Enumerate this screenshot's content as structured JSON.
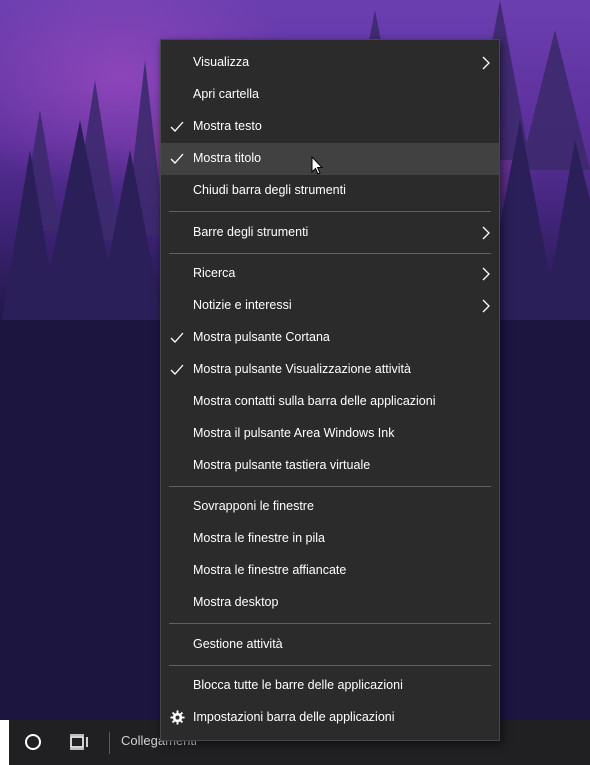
{
  "colors": {
    "menu_background": "#2b2b2b",
    "menu_hover": "#414141",
    "menu_text": "#ffffff",
    "separator": "#5f5f5f",
    "taskbar": "#202023"
  },
  "menu": {
    "items": [
      {
        "label": "Visualizza",
        "submenu": true,
        "checked": false
      },
      {
        "label": "Apri cartella",
        "submenu": false,
        "checked": false
      },
      {
        "label": "Mostra testo",
        "submenu": false,
        "checked": true
      },
      {
        "label": "Mostra titolo",
        "submenu": false,
        "checked": true,
        "hovered": true
      },
      {
        "label": "Chiudi barra degli strumenti",
        "submenu": false,
        "checked": false
      },
      {
        "label": "Barre degli strumenti",
        "submenu": true,
        "checked": false
      },
      {
        "label": "Ricerca",
        "submenu": true,
        "checked": false
      },
      {
        "label": "Notizie e interessi",
        "submenu": true,
        "checked": false
      },
      {
        "label": "Mostra pulsante Cortana",
        "submenu": false,
        "checked": true
      },
      {
        "label": "Mostra pulsante Visualizzazione attività",
        "submenu": false,
        "checked": true
      },
      {
        "label": "Mostra contatti sulla barra delle applicazioni",
        "submenu": false,
        "checked": false
      },
      {
        "label": "Mostra il pulsante Area Windows Ink",
        "submenu": false,
        "checked": false
      },
      {
        "label": "Mostra pulsante tastiera virtuale",
        "submenu": false,
        "checked": false
      },
      {
        "label": "Sovrapponi le finestre",
        "submenu": false,
        "checked": false
      },
      {
        "label": "Mostra le finestre in pila",
        "submenu": false,
        "checked": false
      },
      {
        "label": "Mostra le finestre affiancate",
        "submenu": false,
        "checked": false
      },
      {
        "label": "Mostra desktop",
        "submenu": false,
        "checked": false
      },
      {
        "label": "Gestione attività",
        "submenu": false,
        "checked": false
      },
      {
        "label": "Blocca tutte le barre delle applicazioni",
        "submenu": false,
        "checked": false
      },
      {
        "label": "Impostazioni barra delle applicazioni",
        "submenu": false,
        "checked": false,
        "icon": "gear-icon"
      }
    ]
  },
  "taskbar": {
    "links_label": "Collegamenti",
    "cortana_icon": "circle-icon",
    "task_view_icon": "task-view-icon"
  }
}
